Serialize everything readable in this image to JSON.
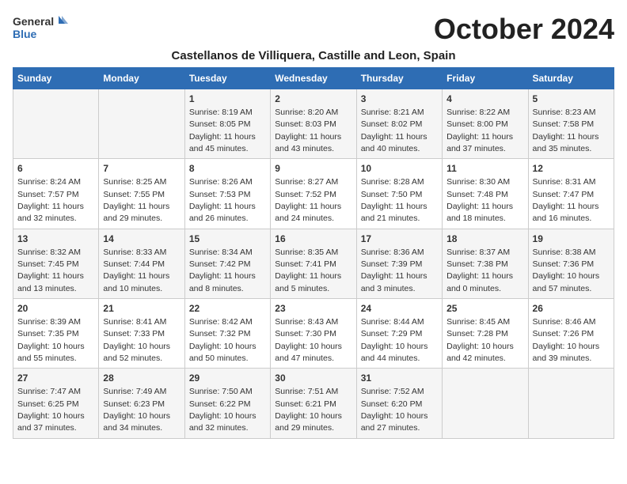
{
  "header": {
    "logo_line1": "General",
    "logo_line2": "Blue",
    "month": "October 2024",
    "location": "Castellanos de Villiquera, Castille and Leon, Spain"
  },
  "weekdays": [
    "Sunday",
    "Monday",
    "Tuesday",
    "Wednesday",
    "Thursday",
    "Friday",
    "Saturday"
  ],
  "weeks": [
    [
      {
        "day": "",
        "detail": ""
      },
      {
        "day": "",
        "detail": ""
      },
      {
        "day": "1",
        "detail": "Sunrise: 8:19 AM\nSunset: 8:05 PM\nDaylight: 11 hours\nand 45 minutes."
      },
      {
        "day": "2",
        "detail": "Sunrise: 8:20 AM\nSunset: 8:03 PM\nDaylight: 11 hours\nand 43 minutes."
      },
      {
        "day": "3",
        "detail": "Sunrise: 8:21 AM\nSunset: 8:02 PM\nDaylight: 11 hours\nand 40 minutes."
      },
      {
        "day": "4",
        "detail": "Sunrise: 8:22 AM\nSunset: 8:00 PM\nDaylight: 11 hours\nand 37 minutes."
      },
      {
        "day": "5",
        "detail": "Sunrise: 8:23 AM\nSunset: 7:58 PM\nDaylight: 11 hours\nand 35 minutes."
      }
    ],
    [
      {
        "day": "6",
        "detail": "Sunrise: 8:24 AM\nSunset: 7:57 PM\nDaylight: 11 hours\nand 32 minutes."
      },
      {
        "day": "7",
        "detail": "Sunrise: 8:25 AM\nSunset: 7:55 PM\nDaylight: 11 hours\nand 29 minutes."
      },
      {
        "day": "8",
        "detail": "Sunrise: 8:26 AM\nSunset: 7:53 PM\nDaylight: 11 hours\nand 26 minutes."
      },
      {
        "day": "9",
        "detail": "Sunrise: 8:27 AM\nSunset: 7:52 PM\nDaylight: 11 hours\nand 24 minutes."
      },
      {
        "day": "10",
        "detail": "Sunrise: 8:28 AM\nSunset: 7:50 PM\nDaylight: 11 hours\nand 21 minutes."
      },
      {
        "day": "11",
        "detail": "Sunrise: 8:30 AM\nSunset: 7:48 PM\nDaylight: 11 hours\nand 18 minutes."
      },
      {
        "day": "12",
        "detail": "Sunrise: 8:31 AM\nSunset: 7:47 PM\nDaylight: 11 hours\nand 16 minutes."
      }
    ],
    [
      {
        "day": "13",
        "detail": "Sunrise: 8:32 AM\nSunset: 7:45 PM\nDaylight: 11 hours\nand 13 minutes."
      },
      {
        "day": "14",
        "detail": "Sunrise: 8:33 AM\nSunset: 7:44 PM\nDaylight: 11 hours\nand 10 minutes."
      },
      {
        "day": "15",
        "detail": "Sunrise: 8:34 AM\nSunset: 7:42 PM\nDaylight: 11 hours\nand 8 minutes."
      },
      {
        "day": "16",
        "detail": "Sunrise: 8:35 AM\nSunset: 7:41 PM\nDaylight: 11 hours\nand 5 minutes."
      },
      {
        "day": "17",
        "detail": "Sunrise: 8:36 AM\nSunset: 7:39 PM\nDaylight: 11 hours\nand 3 minutes."
      },
      {
        "day": "18",
        "detail": "Sunrise: 8:37 AM\nSunset: 7:38 PM\nDaylight: 11 hours\nand 0 minutes."
      },
      {
        "day": "19",
        "detail": "Sunrise: 8:38 AM\nSunset: 7:36 PM\nDaylight: 10 hours\nand 57 minutes."
      }
    ],
    [
      {
        "day": "20",
        "detail": "Sunrise: 8:39 AM\nSunset: 7:35 PM\nDaylight: 10 hours\nand 55 minutes."
      },
      {
        "day": "21",
        "detail": "Sunrise: 8:41 AM\nSunset: 7:33 PM\nDaylight: 10 hours\nand 52 minutes."
      },
      {
        "day": "22",
        "detail": "Sunrise: 8:42 AM\nSunset: 7:32 PM\nDaylight: 10 hours\nand 50 minutes."
      },
      {
        "day": "23",
        "detail": "Sunrise: 8:43 AM\nSunset: 7:30 PM\nDaylight: 10 hours\nand 47 minutes."
      },
      {
        "day": "24",
        "detail": "Sunrise: 8:44 AM\nSunset: 7:29 PM\nDaylight: 10 hours\nand 44 minutes."
      },
      {
        "day": "25",
        "detail": "Sunrise: 8:45 AM\nSunset: 7:28 PM\nDaylight: 10 hours\nand 42 minutes."
      },
      {
        "day": "26",
        "detail": "Sunrise: 8:46 AM\nSunset: 7:26 PM\nDaylight: 10 hours\nand 39 minutes."
      }
    ],
    [
      {
        "day": "27",
        "detail": "Sunrise: 7:47 AM\nSunset: 6:25 PM\nDaylight: 10 hours\nand 37 minutes."
      },
      {
        "day": "28",
        "detail": "Sunrise: 7:49 AM\nSunset: 6:23 PM\nDaylight: 10 hours\nand 34 minutes."
      },
      {
        "day": "29",
        "detail": "Sunrise: 7:50 AM\nSunset: 6:22 PM\nDaylight: 10 hours\nand 32 minutes."
      },
      {
        "day": "30",
        "detail": "Sunrise: 7:51 AM\nSunset: 6:21 PM\nDaylight: 10 hours\nand 29 minutes."
      },
      {
        "day": "31",
        "detail": "Sunrise: 7:52 AM\nSunset: 6:20 PM\nDaylight: 10 hours\nand 27 minutes."
      },
      {
        "day": "",
        "detail": ""
      },
      {
        "day": "",
        "detail": ""
      }
    ]
  ]
}
